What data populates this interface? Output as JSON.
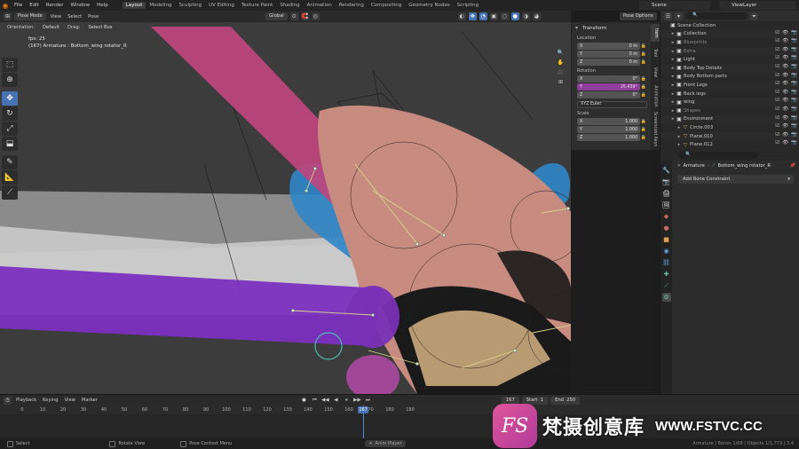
{
  "menu": {
    "items": [
      "File",
      "Edit",
      "Render",
      "Window",
      "Help"
    ],
    "workspaces": [
      "Layout",
      "Modeling",
      "Sculpting",
      "UV Editing",
      "Texture Paint",
      "Shading",
      "Animation",
      "Rendering",
      "Compositing",
      "Geometry Nodes",
      "Scripting"
    ],
    "active_workspace": "Layout",
    "scene": "Scene",
    "view_layer": "ViewLayer"
  },
  "viewport_header": {
    "mode": "Pose Mode",
    "menus": [
      "View",
      "Select",
      "Pose"
    ],
    "transform_orientation": "Global",
    "pose_options": "Pose Options"
  },
  "tool_header": {
    "orientation_label": "Orientation:",
    "orientation_value": "Default",
    "drag_label": "Drag:",
    "drag_value": "Select Box"
  },
  "viewport_overlay": {
    "fps": "fps: 25",
    "object_info": "(167) Armature : Bottom_wing rotator_R"
  },
  "npanel": {
    "section": "Transform",
    "location_label": "Location",
    "location": [
      {
        "axis": "X",
        "value": "0 m"
      },
      {
        "axis": "Y",
        "value": "0 m"
      },
      {
        "axis": "Z",
        "value": "0 m"
      }
    ],
    "rotation_label": "Rotation",
    "rotation": [
      {
        "axis": "X",
        "value": "0°"
      },
      {
        "axis": "Y",
        "value": "25.439°"
      },
      {
        "axis": "Z",
        "value": "0°"
      }
    ],
    "rotation_mode": "XYZ Euler",
    "scale_label": "Scale",
    "scale": [
      {
        "axis": "X",
        "value": "1.000"
      },
      {
        "axis": "Y",
        "value": "1.000"
      },
      {
        "axis": "Z",
        "value": "1.000"
      }
    ],
    "tabs": [
      "Item",
      "Tool",
      "View",
      "Animation",
      "Screencast Keys"
    ]
  },
  "outliner": {
    "rows": [
      {
        "name": "Scene Collection",
        "level": 0,
        "icon": "collection-icon",
        "color": "#c8c8c8"
      },
      {
        "name": "Collection",
        "level": 1,
        "icon": "collection-icon",
        "color": "#c8c8c8"
      },
      {
        "name": "Blueprints",
        "level": 1,
        "icon": "collection-icon",
        "color": "#8a8a8a"
      },
      {
        "name": "Extra",
        "level": 1,
        "icon": "collection-icon",
        "color": "#8a8a8a"
      },
      {
        "name": "Light",
        "level": 1,
        "icon": "collection-icon",
        "color": "#c8c8c8"
      },
      {
        "name": "Body Top Details",
        "level": 1,
        "icon": "collection-icon",
        "color": "#c8c8c8"
      },
      {
        "name": "Body Bottom parts",
        "level": 1,
        "icon": "collection-icon",
        "color": "#c8c8c8"
      },
      {
        "name": "Front Legs",
        "level": 1,
        "icon": "collection-icon",
        "color": "#c8c8c8"
      },
      {
        "name": "Back legs",
        "level": 1,
        "icon": "collection-icon",
        "color": "#c8c8c8"
      },
      {
        "name": "wing",
        "level": 1,
        "icon": "collection-icon",
        "color": "#c8c8c8"
      },
      {
        "name": "Shapes",
        "level": 1,
        "icon": "collection-icon",
        "color": "#8a8a8a"
      },
      {
        "name": "Environment",
        "level": 1,
        "icon": "collection-icon",
        "color": "#c8c8c8"
      },
      {
        "name": "Circle.003",
        "level": 2,
        "icon": "mesh-icon",
        "color": "#c8c8c8"
      },
      {
        "name": "Plane.010",
        "level": 2,
        "icon": "mesh-icon",
        "color": "#c8c8c8"
      },
      {
        "name": "Plane.012",
        "level": 2,
        "icon": "mesh-icon",
        "color": "#c8c8c8"
      }
    ]
  },
  "properties": {
    "armature": "Armature",
    "bone": "Bottom_wing rotator_R",
    "add_constraint": "Add Bone Constraint"
  },
  "timeline": {
    "menus": [
      "Playback",
      "Keying",
      "View",
      "Marker"
    ],
    "current_frame": "167",
    "start_label": "Start",
    "start": "1",
    "end_label": "End",
    "end": "250",
    "ticks": [
      "0",
      "10",
      "20",
      "30",
      "40",
      "50",
      "60",
      "70",
      "80",
      "90",
      "100",
      "110",
      "120",
      "130",
      "140",
      "150",
      "160",
      "170",
      "180",
      "190"
    ],
    "playhead_frame": 167
  },
  "statusbar": {
    "select": "Select",
    "rotate": "Rotate View",
    "context": "Pose Context Menu",
    "anim_player": "Anim Player",
    "stats": "Armature | Bones 1/68 | Objects 1/1,773 | 3.4"
  },
  "watermark": {
    "badge": "FS",
    "cn": "梵摄创意库",
    "en": "WWW.FSTVC.CC"
  },
  "colors": {
    "accent": "#4772b3",
    "selected_field": "#8f3f9b",
    "brand_orange": "#e87d0d"
  }
}
